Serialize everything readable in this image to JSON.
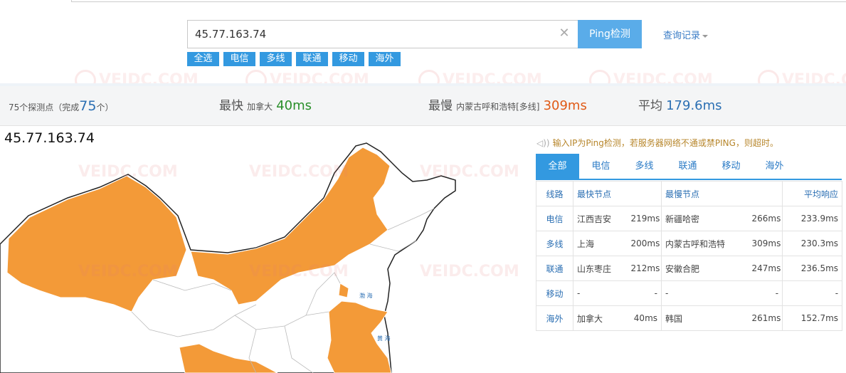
{
  "search": {
    "value": "45.77.163.74",
    "clear_icon": "close-icon",
    "ping_label": "Ping检测",
    "history_label": "查询记录"
  },
  "filters": [
    "全选",
    "电信",
    "多线",
    "联通",
    "移动",
    "海外"
  ],
  "colors": {
    "accent": "#3399e0",
    "fast": "#2a8f2a",
    "slow": "#e05a16",
    "province_fill": "#f39a38"
  },
  "stats": {
    "points_prefix": "75个探测点（完成",
    "points_done": "75",
    "points_suffix": "个）",
    "fastest_label": "最快",
    "fastest_loc": "加拿大",
    "fastest_value": "40ms",
    "slowest_label": "最慢",
    "slowest_loc": "内蒙古呼和浩特[多线]",
    "slowest_value": "309ms",
    "avg_label": "平均",
    "avg_value": "179.6ms"
  },
  "map": {
    "ip_label": "45.77.163.74"
  },
  "notice": "输入IP为Ping检测，若服务器网络不通或禁PING，则超时。",
  "tabs": [
    "全部",
    "电信",
    "多线",
    "联通",
    "移动",
    "海外"
  ],
  "table": {
    "headers": {
      "line": "线路",
      "fastest": "最快节点",
      "slowest": "最慢节点",
      "avg": "平均响应"
    },
    "rows": [
      {
        "line": "电信",
        "fast_node": "江西吉安",
        "fast_ms": "219ms",
        "slow_node": "新疆哈密",
        "slow_ms": "266ms",
        "avg": "233.9ms"
      },
      {
        "line": "多线",
        "fast_node": "上海",
        "fast_ms": "200ms",
        "slow_node": "内蒙古呼和浩特",
        "slow_ms": "309ms",
        "avg": "230.3ms"
      },
      {
        "line": "联通",
        "fast_node": "山东枣庄",
        "fast_ms": "212ms",
        "slow_node": "安徽合肥",
        "slow_ms": "247ms",
        "avg": "236.5ms"
      },
      {
        "line": "移动",
        "fast_node": "-",
        "fast_ms": "-",
        "slow_node": "-",
        "slow_ms": "-",
        "avg": "-"
      },
      {
        "line": "海外",
        "fast_node": "加拿大",
        "fast_ms": "40ms",
        "slow_node": "韩国",
        "slow_ms": "261ms",
        "avg": "152.7ms"
      }
    ]
  },
  "watermark": "VEIDC.COM"
}
